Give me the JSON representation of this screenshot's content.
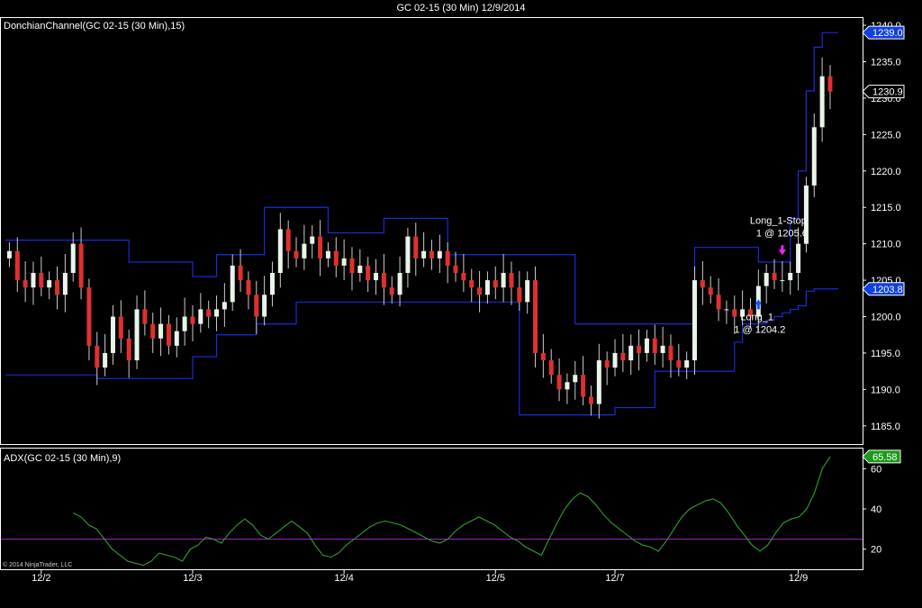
{
  "window": {
    "title": "GC 02-15 (30 Min)  12/9/2014"
  },
  "copyright": "© 2014 NinjaTrader, LLC",
  "colors": {
    "background": "#000000",
    "up_candle": "#e8f5e8",
    "down_candle": "#e03030",
    "candle_wick": "#cccccc",
    "donchian": "#1a2bd8",
    "adx": "#2fa02f",
    "adx_level": "#a020c0",
    "price_badge_bg": "#1040e0",
    "adx_badge_bg": "#1b9a1b",
    "long_marker": "#1b4fff",
    "stop_marker": "#ff20ff"
  },
  "chart_data": [
    {
      "type": "candlestick",
      "title": "DonchianChannel(GC 02-15 (30 Min),15)",
      "ylim": [
        1182.5,
        1241.0
      ],
      "yticks": [
        1185.0,
        1190.0,
        1195.0,
        1200.0,
        1205.0,
        1210.0,
        1215.0,
        1220.0,
        1225.0,
        1230.0,
        1235.0,
        1240.0
      ],
      "x_tick_labels": [
        {
          "label": "12/2",
          "bar": 4
        },
        {
          "label": "12/3",
          "bar": 23
        },
        {
          "label": "12/4",
          "bar": 42
        },
        {
          "label": "12/5",
          "bar": 61
        },
        {
          "label": "12/7",
          "bar": 76
        },
        {
          "label": "12/9",
          "bar": 99
        }
      ],
      "closes": [
        1209,
        1205,
        1204,
        1206,
        1204,
        1205,
        1203,
        1206,
        1210,
        1204,
        1196,
        1193,
        1195,
        1200,
        1197,
        1194,
        1201,
        1199,
        1197,
        1199,
        1196,
        1198,
        1200,
        1199,
        1201,
        1200,
        1201,
        1202,
        1207,
        1205,
        1203,
        1200,
        1203,
        1206,
        1212,
        1209,
        1208,
        1210,
        1211,
        1208,
        1209,
        1207,
        1208,
        1206,
        1207,
        1205,
        1206,
        1204,
        1203,
        1206,
        1211,
        1208,
        1209,
        1208,
        1209,
        1207,
        1206,
        1205,
        1204,
        1203,
        1205,
        1204,
        1206,
        1204,
        1202,
        1205,
        1195,
        1194,
        1192,
        1190,
        1191,
        1192,
        1189,
        1188,
        1194,
        1193,
        1195,
        1194,
        1196,
        1195,
        1197,
        1195,
        1196,
        1194,
        1193,
        1194,
        1205,
        1204,
        1203,
        1201,
        1201,
        1200,
        1201,
        1200,
        1204.2,
        1206,
        1205,
        1205,
        1206,
        1210,
        1218,
        1226,
        1233,
        1230.9
      ],
      "donchian_upper": [
        1210.5,
        1210.5,
        1210.5,
        1210.5,
        1210.5,
        1210.5,
        1210.5,
        1210.5,
        1210.5,
        1210.5,
        1210.5,
        1210.5,
        1210.5,
        1210.5,
        1210.5,
        1207.5,
        1207.5,
        1207.5,
        1207.5,
        1207.5,
        1207.5,
        1207.5,
        1207.5,
        1205.5,
        1205.5,
        1205.5,
        1208.5,
        1208.5,
        1208.5,
        1208.5,
        1208.5,
        1208.5,
        1215.0,
        1215.0,
        1215.0,
        1215.0,
        1215.0,
        1215.0,
        1215.0,
        1215.0,
        1211.5,
        1211.5,
        1211.5,
        1211.5,
        1211.5,
        1211.5,
        1211.5,
        1213.5,
        1213.5,
        1213.5,
        1213.5,
        1213.5,
        1213.5,
        1213.5,
        1213.5,
        1208.5,
        1208.5,
        1208.5,
        1208.5,
        1208.5,
        1208.5,
        1208.5,
        1208.5,
        1208.5,
        1208.5,
        1208.5,
        1208.5,
        1208.5,
        1208.5,
        1208.5,
        1208.5,
        1199.0,
        1199.0,
        1199.0,
        1199.0,
        1199.0,
        1199.0,
        1199.0,
        1199.0,
        1199.0,
        1199.0,
        1199.0,
        1199.0,
        1199.0,
        1199.0,
        1199.0,
        1209.5,
        1209.5,
        1209.5,
        1209.5,
        1209.5,
        1209.5,
        1209.5,
        1209.5,
        1207.5,
        1207.5,
        1207.5,
        1207.5,
        1213.5,
        1220.0,
        1231.0,
        1237.0,
        1239.0,
        1239.0
      ],
      "donchian_lower": [
        1192.0,
        1192.0,
        1192.0,
        1192.0,
        1192.0,
        1192.0,
        1192.0,
        1192.0,
        1192.0,
        1192.0,
        1192.0,
        1191.5,
        1191.5,
        1191.5,
        1191.5,
        1191.5,
        1191.5,
        1191.5,
        1191.5,
        1191.5,
        1191.5,
        1191.5,
        1191.5,
        1194.5,
        1194.5,
        1194.5,
        1197.5,
        1197.5,
        1197.5,
        1197.5,
        1197.5,
        1199.0,
        1199.0,
        1199.0,
        1199.0,
        1199.0,
        1202.0,
        1202.0,
        1202.0,
        1202.0,
        1202.0,
        1202.0,
        1202.0,
        1202.0,
        1202.0,
        1202.0,
        1202.0,
        1202.0,
        1202.0,
        1202.0,
        1202.0,
        1202.0,
        1202.0,
        1202.0,
        1202.0,
        1202.0,
        1202.0,
        1202.0,
        1202.0,
        1202.0,
        1202.0,
        1202.0,
        1202.0,
        1202.0,
        1186.5,
        1186.5,
        1186.5,
        1186.5,
        1186.5,
        1186.5,
        1186.5,
        1186.5,
        1186.5,
        1186.5,
        1186.5,
        1186.5,
        1187.5,
        1187.5,
        1187.5,
        1187.5,
        1187.5,
        1192.5,
        1192.5,
        1192.5,
        1192.5,
        1192.5,
        1192.5,
        1192.5,
        1192.5,
        1192.5,
        1192.5,
        1196.5,
        1199.0,
        1199.0,
        1199.0,
        1199.5,
        1200.0,
        1200.5,
        1201.0,
        1201.5,
        1203.5,
        1203.8,
        1203.8,
        1203.8
      ],
      "price_badges": [
        {
          "value": 1239.0,
          "label": "1239.0",
          "style": "filled"
        },
        {
          "value": 1230.9,
          "label": "1230.9",
          "style": "outline"
        },
        {
          "value": 1203.8,
          "label": "1203.8",
          "style": "filled"
        }
      ],
      "trade_markers": [
        {
          "bar": 94,
          "price": 1201.5,
          "type": "buy",
          "label1": "Long_1",
          "label2": "1 @ 1204.2"
        },
        {
          "bar": 97,
          "price": 1209.3,
          "type": "stop",
          "label1": "Long_1-Stop",
          "label2": "1 @ 1205.6"
        }
      ]
    },
    {
      "type": "line",
      "title": "ADX(GC 02-15 (30 Min),9)",
      "ylim": [
        10,
        70
      ],
      "yticks": [
        20,
        40,
        60
      ],
      "level_line": 25,
      "current_badge": "65.58",
      "series": [
        {
          "values": [
            38,
            36,
            32,
            30,
            25,
            20,
            17,
            14,
            13,
            12,
            14,
            18,
            17,
            16,
            14,
            20,
            22,
            26,
            25,
            23,
            28,
            32,
            35,
            32,
            27,
            25,
            28,
            31,
            34,
            31,
            28,
            22,
            17,
            16,
            18,
            22,
            25,
            28,
            31,
            33,
            34,
            33,
            32,
            30,
            28,
            26,
            24,
            23,
            25,
            29,
            32,
            34,
            36,
            34,
            32,
            29,
            26,
            24,
            21,
            19,
            17,
            25,
            33,
            40,
            45,
            48,
            46,
            42,
            37,
            33,
            30,
            27,
            24,
            22,
            21,
            19,
            24,
            30,
            36,
            40,
            42,
            44,
            45,
            43,
            38,
            32,
            27,
            22,
            19,
            22,
            28,
            33,
            35,
            36,
            40,
            48,
            60,
            66
          ]
        }
      ]
    }
  ]
}
